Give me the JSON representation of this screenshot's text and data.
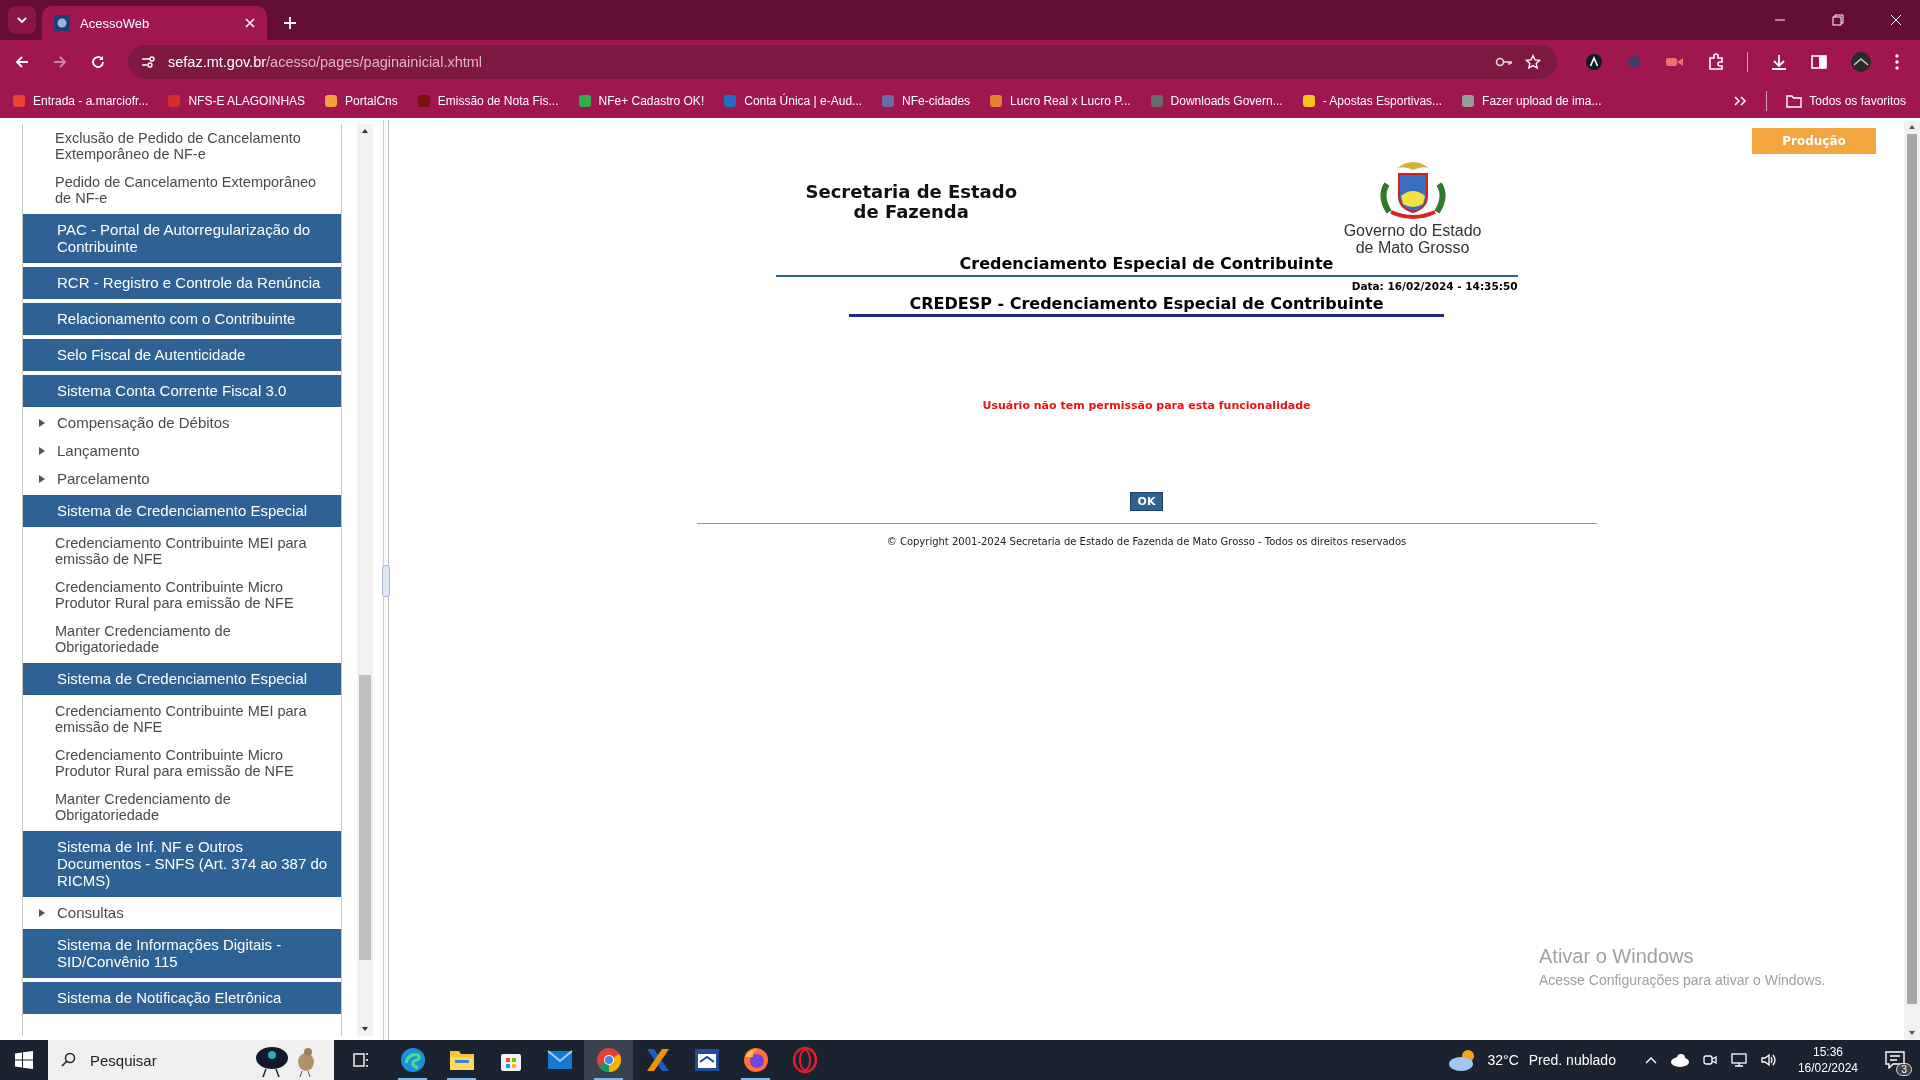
{
  "browser": {
    "tab": {
      "title": "AcessoWeb",
      "selected": true
    },
    "url": {
      "host": "sefaz.mt.gov.br",
      "path": "/acesso/pages/paginainicial.xhtml"
    },
    "bookmarks": [
      {
        "label": "Entrada - a.marciofr...",
        "color": "#ea4335"
      },
      {
        "label": "NFS-E ALAGOINHAS",
        "color": "#d62d2d"
      },
      {
        "label": "PortalCns",
        "color": "#f2a23a"
      },
      {
        "label": "Emissão de Nota Fis...",
        "color": "#7a1010"
      },
      {
        "label": "NFe+ Cadastro OK!",
        "color": "#2fae4a"
      },
      {
        "label": "Conta Única | e-Aud...",
        "color": "#1f6fc4"
      },
      {
        "label": "NFe-cidades",
        "color": "#6a6aa8"
      },
      {
        "label": "Lucro Real x Lucro P...",
        "color": "#e2822c"
      },
      {
        "label": "Downloads Govern...",
        "color": "#6a6a6a"
      },
      {
        "label": "- Apostas Esportivas...",
        "color": "#f5c518"
      },
      {
        "label": "Fazer upload de ima...",
        "color": "#9a9a9a"
      }
    ],
    "all_bookmarks": "Todos os favoritos"
  },
  "sidebar": {
    "items": [
      {
        "kind": "link",
        "label": "Exclusão de Pedido de Cancelamento Extemporâneo de NF-e"
      },
      {
        "kind": "link",
        "label": "Pedido de Cancelamento Extemporâneo de NF-e"
      },
      {
        "kind": "header",
        "label": "PAC - Portal de Autorregularização do Contribuinte"
      },
      {
        "kind": "header",
        "label": "RCR - Registro e Controle da Renúncia"
      },
      {
        "kind": "header",
        "label": "Relacionamento com o Contribuinte"
      },
      {
        "kind": "header",
        "label": "Selo Fiscal de Autenticidade"
      },
      {
        "kind": "header",
        "label": "Sistema Conta Corrente Fiscal 3.0"
      },
      {
        "kind": "expandable",
        "label": "Compensação de Débitos"
      },
      {
        "kind": "expandable",
        "label": "Lançamento"
      },
      {
        "kind": "expandable",
        "label": "Parcelamento"
      },
      {
        "kind": "header",
        "label": "Sistema de Credenciamento Especial"
      },
      {
        "kind": "link",
        "label": "Credenciamento Contribuinte MEI para emissão de NFE"
      },
      {
        "kind": "link",
        "label": "Credenciamento Contribuinte Micro Produtor Rural para emissão de NFE"
      },
      {
        "kind": "link",
        "label": "Manter Credenciamento de Obrigatoriedade"
      },
      {
        "kind": "header",
        "label": "Sistema de Credenciamento Especial"
      },
      {
        "kind": "link",
        "label": "Credenciamento Contribuinte MEI para emissão de NFE"
      },
      {
        "kind": "link",
        "label": "Credenciamento Contribuinte Micro Produtor Rural para emissão de NFE"
      },
      {
        "kind": "link",
        "label": "Manter Credenciamento de Obrigatoriedade"
      },
      {
        "kind": "header",
        "label": "Sistema de Inf. NF e Outros Documentos - SNFS (Art. 374 ao 387 do RICMS)"
      },
      {
        "kind": "expandable",
        "label": "Consultas"
      },
      {
        "kind": "header",
        "label": "Sistema de Informações Digitais - SID/Convênio 115"
      },
      {
        "kind": "header",
        "label": "Sistema de Notificação Eletrônica"
      }
    ]
  },
  "page": {
    "environment_badge": "Produção",
    "org_name": [
      "Secretaria de Estado",
      "de Fazenda"
    ],
    "government_logo_text": [
      "Governo do Estado",
      "de Mato Grosso"
    ],
    "title": "Credenciamento Especial de Contribuinte",
    "date": "Data: 16/02/2024 - 14:35:50",
    "subtitle": "CREDESP - Credenciamento Especial de Contribuinte",
    "error_message": "Usuário não tem permissão para esta funcionalidade",
    "ok_button": "OK",
    "copyright": "© Copyright 2001-2024 Secretaria de Estado de Fazenda de Mato Grosso - Todos os direitos reservados"
  },
  "activation_notice": {
    "title": "Ativar o Windows",
    "text": "Acesse Configurações para ativar o Windows."
  },
  "taskbar": {
    "search_placeholder": "Pesquisar",
    "apps": [
      {
        "kind": "swirl",
        "running": true,
        "selected": false
      },
      {
        "kind": "folder",
        "running": true,
        "selected": false
      },
      {
        "kind": "bag",
        "running": false,
        "selected": false
      },
      {
        "kind": "mail",
        "running": false,
        "selected": false
      },
      {
        "kind": "chrome",
        "running": true,
        "selected": true
      },
      {
        "kind": "x",
        "running": false,
        "selected": false
      },
      {
        "kind": "window",
        "running": false,
        "selected": false
      },
      {
        "kind": "fox",
        "running": true,
        "selected": false
      },
      {
        "kind": "ring",
        "running": false,
        "selected": false
      }
    ],
    "temperature": "32°C",
    "weather": "Pred. nublado",
    "time": "15:36",
    "date": "16/02/2024",
    "notifications": "3"
  }
}
